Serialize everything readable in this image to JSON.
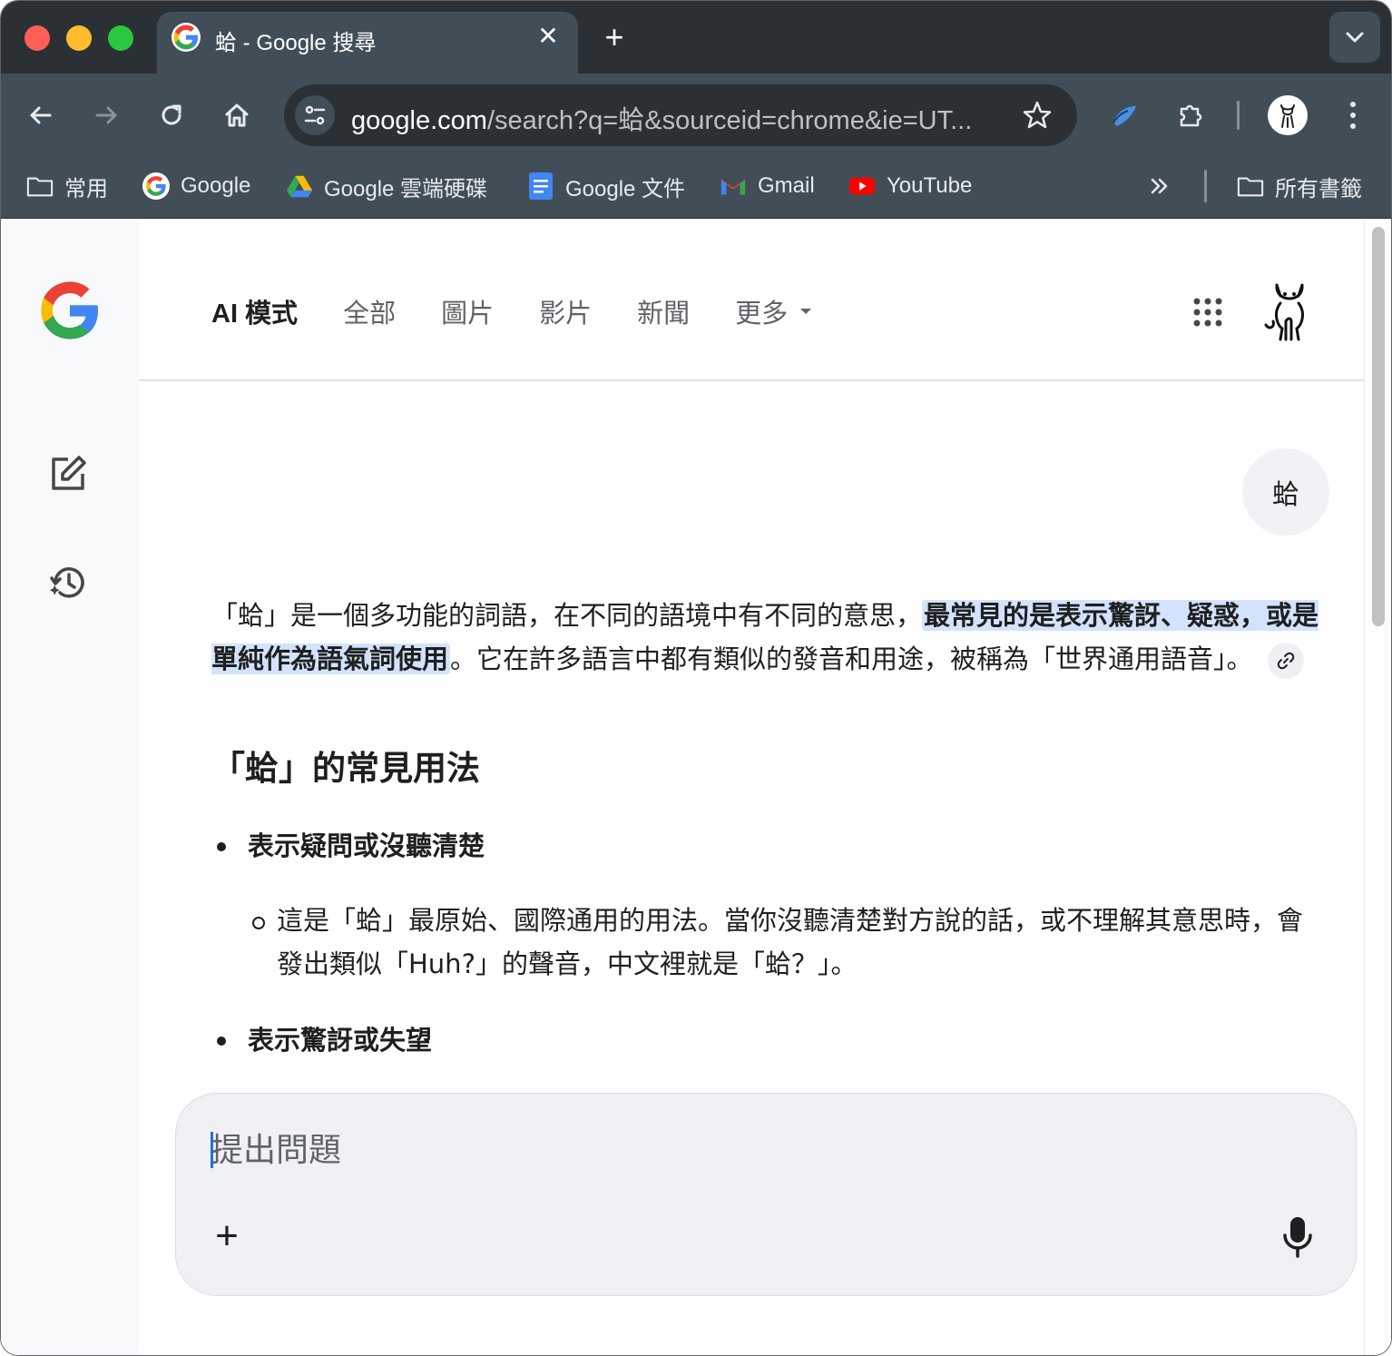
{
  "browser": {
    "tab": {
      "title": "蛤 - Google 搜尋"
    },
    "url": {
      "host": "google.com",
      "path": "/search?q=蛤&sourceid=chrome&ie=UT..."
    },
    "bookmarks": [
      {
        "label": "常用",
        "icon": "folder-icon"
      },
      {
        "label": "Google",
        "icon": "google-icon"
      },
      {
        "label": "Google 雲端硬碟",
        "icon": "drive-icon"
      },
      {
        "label": "Google 文件",
        "icon": "docs-icon"
      },
      {
        "label": "Gmail",
        "icon": "gmail-icon"
      },
      {
        "label": "YouTube",
        "icon": "youtube-icon"
      }
    ],
    "bookmarks_more_icon": "chevron-double-right-icon",
    "all_bookmarks": "所有書籤"
  },
  "search": {
    "nav": [
      "AI 模式",
      "全部",
      "圖片",
      "影片",
      "新聞",
      "更多"
    ],
    "active_nav": "AI 模式",
    "query_bubble": "蛤"
  },
  "answer": {
    "intro_before": "「蛤」是一個多功能的詞語，在不同的語境中有不同的意思，",
    "intro_highlight": "最常見的是表示驚訝、疑惑，或是單純作為語氣詞使用",
    "intro_after": "。它在許多語言中都有類似的發音和用途，被稱為「世界通用語音」。",
    "heading": "「蛤」的常見用法",
    "bullets": [
      {
        "title": "表示疑問或沒聽清楚",
        "sub": "這是「蛤」最原始、國際通用的用法。當你沒聽清楚對方說的話，或不理解其意思時，會發出類似「Huh?」的聲音，中文裡就是「蛤？」。"
      },
      {
        "title": "表示驚訝或失望"
      }
    ]
  },
  "ask": {
    "placeholder": "提出問題"
  },
  "colors": {
    "tabstrip": "#2b3035",
    "toolbar": "#414e58",
    "highlight": "#d3e3fd",
    "rail": "#f8f9fa",
    "askbox": "#eff1f5"
  }
}
